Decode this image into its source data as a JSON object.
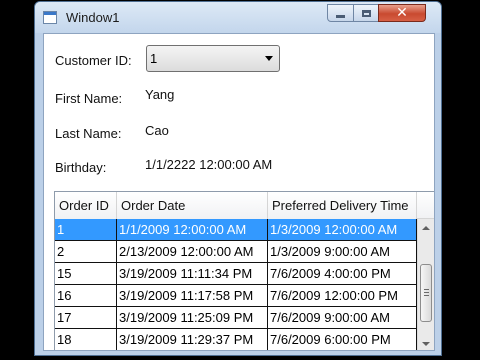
{
  "window": {
    "title": "Window1"
  },
  "form": {
    "customer_id": {
      "label": "Customer ID:",
      "value": "1"
    },
    "first_name": {
      "label": "First Name:",
      "value": "Yang"
    },
    "last_name": {
      "label": "Last Name:",
      "value": "Cao"
    },
    "birthday": {
      "label": "Birthday:",
      "value": "1/1/2222 12:00:00 AM"
    }
  },
  "grid": {
    "columns": [
      "Order ID",
      "Order Date",
      "Preferred Delivery Time"
    ],
    "selected_index": 0,
    "rows": [
      [
        "1",
        "1/1/2009 12:00:00 AM",
        "1/3/2009 12:00:00 AM"
      ],
      [
        "2",
        "2/13/2009 12:00:00 AM",
        "1/3/2009 9:00:00 AM"
      ],
      [
        "15",
        "3/19/2009 11:11:34 PM",
        "7/6/2009 4:00:00 PM"
      ],
      [
        "16",
        "3/19/2009 11:17:58 PM",
        "7/6/2009 12:00:00 PM"
      ],
      [
        "17",
        "3/19/2009 11:25:09 PM",
        "7/6/2009 9:00:00 AM"
      ],
      [
        "18",
        "3/19/2009 11:29:37 PM",
        "7/6/2009 6:00:00 PM"
      ]
    ]
  },
  "icons": {
    "app": "window-icon",
    "minimize": "minimize-icon",
    "maximize": "maximize-icon",
    "close": "close-icon",
    "combo": "chevron-down-icon"
  },
  "colors": {
    "selection": "#3399ff",
    "close_button": "#c94a30",
    "title_bar": "#c3d6ec"
  }
}
